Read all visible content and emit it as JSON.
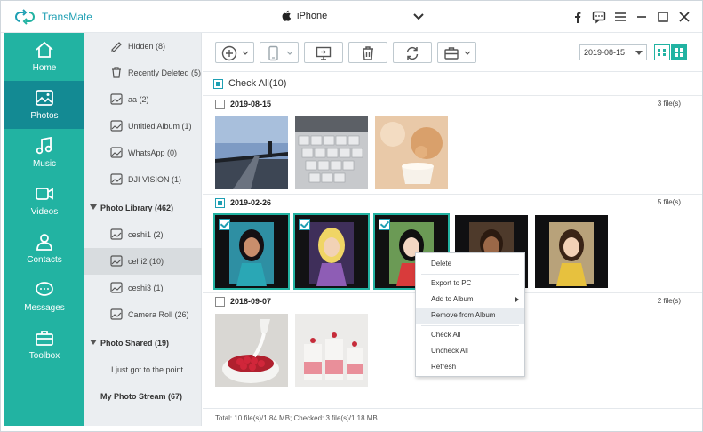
{
  "app": {
    "title": "TransMate",
    "brand_color": "#22b3a2",
    "active_nav_color": "#138a93"
  },
  "device": {
    "name": "iPhone"
  },
  "window_controls": [
    "facebook-icon",
    "feedback-icon",
    "menu-icon",
    "minimize-icon",
    "maximize-icon",
    "close-icon"
  ],
  "nav": [
    {
      "label": "Home",
      "icon": "home-icon",
      "active": false
    },
    {
      "label": "Photos",
      "icon": "photos-icon",
      "active": true
    },
    {
      "label": "Music",
      "icon": "music-icon",
      "active": false
    },
    {
      "label": "Videos",
      "icon": "videos-icon",
      "active": false
    },
    {
      "label": "Contacts",
      "icon": "contacts-icon",
      "active": false
    },
    {
      "label": "Messages",
      "icon": "messages-icon",
      "active": false
    },
    {
      "label": "Toolbox",
      "icon": "toolbox-icon",
      "active": false
    }
  ],
  "albums": {
    "items": [
      {
        "label": "Hidden (8)",
        "icon": "hidden-album-icon"
      },
      {
        "label": "Recently Deleted (5)",
        "icon": "trash-icon"
      },
      {
        "label": "aa (2)",
        "icon": "album-icon"
      },
      {
        "label": "Untitled Album (1)",
        "icon": "album-icon"
      },
      {
        "label": "WhatsApp (0)",
        "icon": "album-icon"
      },
      {
        "label": "DJI VISION (1)",
        "icon": "album-icon"
      }
    ],
    "photo_library": {
      "label": "Photo Library (462)",
      "items": [
        {
          "label": "ceshi1 (2)",
          "selected": false
        },
        {
          "label": "cehi2 (10)",
          "selected": true
        },
        {
          "label": "ceshi3 (1)",
          "selected": false
        },
        {
          "label": "Camera Roll (26)",
          "selected": false
        }
      ]
    },
    "photo_shared": {
      "label": "Photo Shared (19)",
      "items": [
        {
          "label": "I just got to the point ..."
        }
      ]
    },
    "photo_stream": {
      "label": "My Photo Stream (67)"
    }
  },
  "toolbar": {
    "buttons": [
      "add-icon",
      "export-to-device-icon",
      "export-to-pc-icon",
      "delete-icon",
      "refresh-icon",
      "toolbox-icon"
    ],
    "date_filter": "2019-08-15"
  },
  "content": {
    "check_all": "Check All(10)",
    "groups": [
      {
        "date": "2019-08-15",
        "count": "3 file(s)",
        "checked": "none",
        "photos": [
          {
            "name": "bridge",
            "selected": false
          },
          {
            "name": "keyboard",
            "selected": false
          },
          {
            "name": "cup",
            "selected": false
          }
        ]
      },
      {
        "date": "2019-02-26",
        "count": "5 file(s)",
        "checked": "partial",
        "photos": [
          {
            "name": "princess-1",
            "selected": true
          },
          {
            "name": "princess-2",
            "selected": true
          },
          {
            "name": "princess-3",
            "selected": true
          },
          {
            "name": "princess-4",
            "selected": false
          },
          {
            "name": "princess-5",
            "selected": false
          }
        ]
      },
      {
        "date": "2018-09-07",
        "count": "2 file(s)",
        "checked": "none",
        "photos": [
          {
            "name": "raspberries",
            "selected": false
          },
          {
            "name": "desserts",
            "selected": false
          }
        ]
      }
    ]
  },
  "context_menu": {
    "items": [
      {
        "label": "Delete"
      },
      {
        "label": "Export to PC"
      },
      {
        "label": "Add to Album"
      },
      {
        "label": "Remove from Album"
      },
      {
        "label": "Check All"
      },
      {
        "label": "Uncheck All"
      },
      {
        "label": "Refresh"
      }
    ]
  },
  "status": {
    "text": "Total: 10 file(s)/1.84 MB; Checked: 3 file(s)/1.18 MB"
  }
}
